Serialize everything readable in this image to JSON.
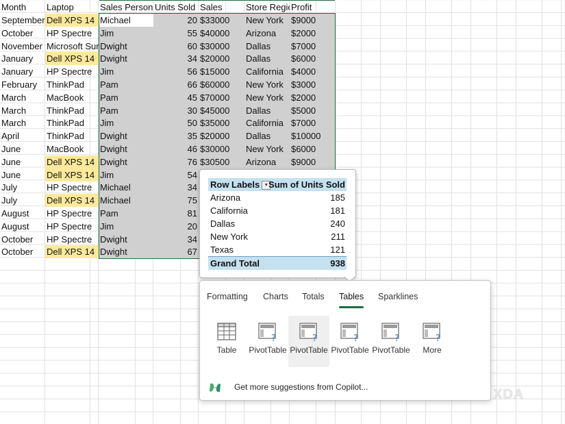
{
  "headers": [
    "Month",
    "Laptop",
    "Sales Person",
    "Units Sold",
    "Sales",
    "Store Regic",
    "Profit"
  ],
  "rows": [
    {
      "month": "September",
      "laptop": "Dell XPS 14",
      "person": "Michael",
      "units": "20",
      "sales": "$33000",
      "region": "New York",
      "profit": "$9000",
      "hl": true
    },
    {
      "month": "October",
      "laptop": "HP Spectre",
      "person": "Jim",
      "units": "55",
      "sales": "$40000",
      "region": "Arizona",
      "profit": "$2000",
      "hl": false
    },
    {
      "month": "November",
      "laptop": "Microsoft Sur",
      "person": "Dwight",
      "units": "60",
      "sales": "$30000",
      "region": "Dallas",
      "profit": "$7000",
      "hl": false
    },
    {
      "month": "January",
      "laptop": "Dell XPS 14",
      "person": "Dwight",
      "units": "34",
      "sales": "$20000",
      "region": "Dallas",
      "profit": "$6000",
      "hl": true
    },
    {
      "month": "January",
      "laptop": "HP Spectre",
      "person": "Jim",
      "units": "56",
      "sales": "$15000",
      "region": "California",
      "profit": "$4000",
      "hl": false
    },
    {
      "month": "February",
      "laptop": "ThinkPad",
      "person": "Pam",
      "units": "66",
      "sales": "$60000",
      "region": "New York",
      "profit": "$3000",
      "hl": false
    },
    {
      "month": "March",
      "laptop": "MacBook",
      "person": "Pam",
      "units": "45",
      "sales": "$70000",
      "region": "New York",
      "profit": "$2000",
      "hl": false
    },
    {
      "month": "March",
      "laptop": "ThinkPad",
      "person": "Pam",
      "units": "30",
      "sales": "$45000",
      "region": "Dallas",
      "profit": "$5000",
      "hl": false
    },
    {
      "month": "March",
      "laptop": "ThinkPad",
      "person": "Jim",
      "units": "50",
      "sales": "$35000",
      "region": "California",
      "profit": "$7000",
      "hl": false
    },
    {
      "month": "April",
      "laptop": "ThinkPad",
      "person": "Dwight",
      "units": "35",
      "sales": "$20000",
      "region": "Dallas",
      "profit": "$10000",
      "hl": false
    },
    {
      "month": "June",
      "laptop": "MacBook",
      "person": "Dwight",
      "units": "46",
      "sales": "$30000",
      "region": "New York",
      "profit": "$6000",
      "hl": false
    },
    {
      "month": "June",
      "laptop": "Dell XPS 14",
      "person": "Dwight",
      "units": "76",
      "sales": "$30500",
      "region": "Arizona",
      "profit": "$9000",
      "hl": true
    },
    {
      "month": "June",
      "laptop": "Dell XPS 14",
      "person": "Jim",
      "units": "54",
      "sales": "",
      "region": "",
      "profit": "",
      "hl": true
    },
    {
      "month": "July",
      "laptop": "HP Spectre",
      "person": "Michael",
      "units": "34",
      "sales": "",
      "region": "",
      "profit": "",
      "hl": false
    },
    {
      "month": "July",
      "laptop": "Dell XPS 14",
      "person": "Michael",
      "units": "75",
      "sales": "",
      "region": "",
      "profit": "",
      "hl": true
    },
    {
      "month": "August",
      "laptop": "HP Spectre",
      "person": "Pam",
      "units": "81",
      "sales": "",
      "region": "",
      "profit": "",
      "hl": false
    },
    {
      "month": "August",
      "laptop": "HP Spectre",
      "person": "Jim",
      "units": "20",
      "sales": "",
      "region": "",
      "profit": "",
      "hl": false
    },
    {
      "month": "October",
      "laptop": "HP Spectre",
      "person": "Dwight",
      "units": "34",
      "sales": "",
      "region": "",
      "profit": "",
      "hl": false
    },
    {
      "month": "October",
      "laptop": "Dell XPS 14",
      "person": "Dwight",
      "units": "67",
      "sales": "",
      "region": "",
      "profit": "",
      "hl": true
    }
  ],
  "pivot": {
    "col1": "Row Labels",
    "col2": "Sum of Units Sold",
    "items": [
      {
        "label": "Arizona",
        "value": "185"
      },
      {
        "label": "California",
        "value": "181"
      },
      {
        "label": "Dallas",
        "value": "240"
      },
      {
        "label": "New York",
        "value": "211"
      },
      {
        "label": "Texas",
        "value": "121"
      }
    ],
    "total_label": "Grand Total",
    "total_value": "938"
  },
  "panel": {
    "tabs": [
      "Formatting",
      "Charts",
      "Totals",
      "Tables",
      "Sparklines"
    ],
    "active_tab": "Tables",
    "options": [
      "Table",
      "PivotTable",
      "PivotTable",
      "PivotTable",
      "PivotTable",
      "More"
    ],
    "copilot_text": "Get more suggestions from Copilot..."
  },
  "watermark": "XDA",
  "colors": {
    "highlight": "#fce99b",
    "selection": "#d0d0d0",
    "pivot_header": "#c5e1f0",
    "accent": "#1d6b3e"
  }
}
